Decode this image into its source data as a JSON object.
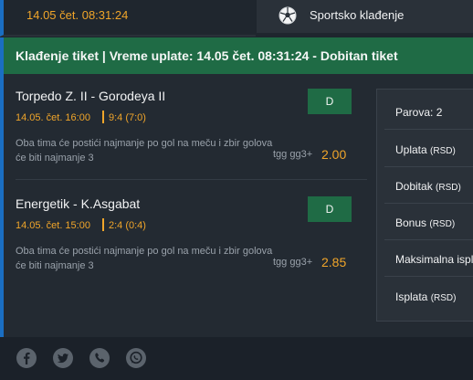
{
  "header": {
    "date": "14.05 čet. 08:31:24",
    "sport_icon": "soccer-ball-icon",
    "sport_label": "Sportsko klađenje"
  },
  "ticket": {
    "banner": "Klađenje tiket | Vreme uplate: 14.05 čet. 08:31:24 - Dobitan tiket"
  },
  "matches": [
    {
      "title": "Torpedo Z. II - Gorodeya II",
      "time": "14.05. čet. 16:00",
      "score": "9:4 (7:0)",
      "status": "D",
      "description": "Oba tima će postići najmanje po gol na meču i zbir golova će biti najmanje 3",
      "market": "tgg gg3+",
      "odds": "2.00"
    },
    {
      "title": "Energetik - K.Asgabat",
      "time": "14.05. čet. 15:00",
      "score": "2:4 (0:4)",
      "status": "D",
      "description": "Oba tima će postići najmanje po gol na meču i zbir golova će biti najmanje 3",
      "market": "tgg gg3+",
      "odds": "2.85"
    }
  ],
  "summary": {
    "pairs": "Parova: 2",
    "payment_label": "Uplata",
    "payment_unit": "(RSD)",
    "win_label": "Dobitak",
    "win_unit": "(RSD)",
    "bonus_label": "Bonus",
    "bonus_unit": "(RSD)",
    "max_label": "Maksimalna ispla",
    "payout_label": "Isplata",
    "payout_unit": "(RSD)"
  },
  "footer": {
    "icons": [
      "facebook-icon",
      "twitter-icon",
      "viber-icon",
      "whatsapp-icon"
    ]
  },
  "colors": {
    "accent_orange": "#f0a52a",
    "win_green": "#1f6b45",
    "accent_blue": "#1a6ec2"
  }
}
